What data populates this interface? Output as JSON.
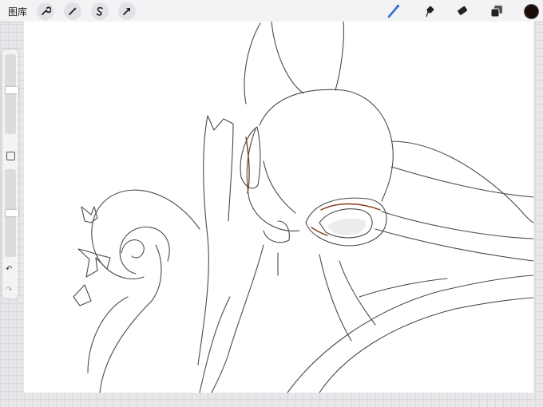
{
  "topbar": {
    "gallery_label": "图库",
    "left_tools": [
      {
        "name": "wrench-icon",
        "label": "actions"
      },
      {
        "name": "magic-wand-icon",
        "label": "adjustments"
      },
      {
        "name": "selection-s-icon",
        "label": "selection"
      },
      {
        "name": "transform-arrow-icon",
        "label": "transform"
      }
    ],
    "right_tools": [
      {
        "name": "brush-icon",
        "active": true
      },
      {
        "name": "smudge-icon",
        "active": false
      },
      {
        "name": "eraser-icon",
        "active": false
      },
      {
        "name": "layers-icon",
        "active": false
      }
    ],
    "active_color": "#1a0c08",
    "accent_color": "#2f6fd6"
  },
  "sidebar": {
    "brush_size_level": 0.55,
    "opacity_level": 0.5,
    "undo_icon": "undo-icon",
    "redo_icon": "redo-icon"
  },
  "canvas": {
    "background": "#ffffff",
    "sketch_stroke_color": "#4a4a4a",
    "sketch_accent_color": "#8a3a1c"
  }
}
